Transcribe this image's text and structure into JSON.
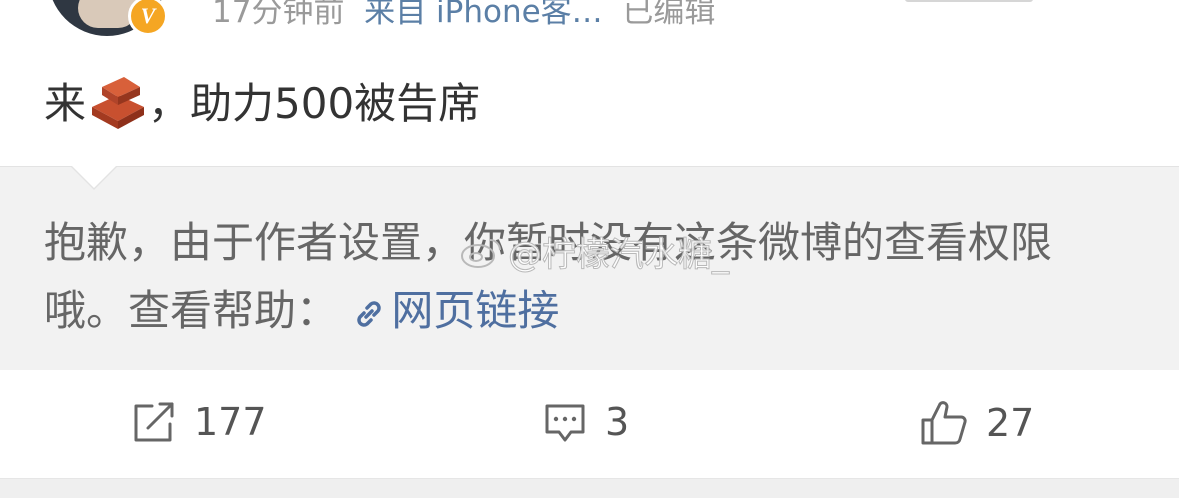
{
  "header": {
    "time": "17分钟前",
    "source": "来自 iPhone客…",
    "edited": "已编辑",
    "badge": "V"
  },
  "post": {
    "text_before": "来",
    "emoji": "brick-emoji",
    "text_after": "，助力500被告席"
  },
  "quote": {
    "text": "抱歉，由于作者设置，你暂时没有这条微博的查看权限哦。查看帮助：",
    "link_label": "网页链接",
    "watermark": "@柠檬汽水糖_"
  },
  "actions": {
    "repost_count": "177",
    "comment_count": "3",
    "like_count": "27"
  },
  "icons": [
    "repost-icon",
    "comment-icon",
    "like-icon",
    "link-icon",
    "verified-badge-icon",
    "weibo-watermark-icon"
  ],
  "colors": {
    "link": "#4f6fa0",
    "badge": "#f5a623",
    "quote_bg": "#f2f2f2"
  }
}
